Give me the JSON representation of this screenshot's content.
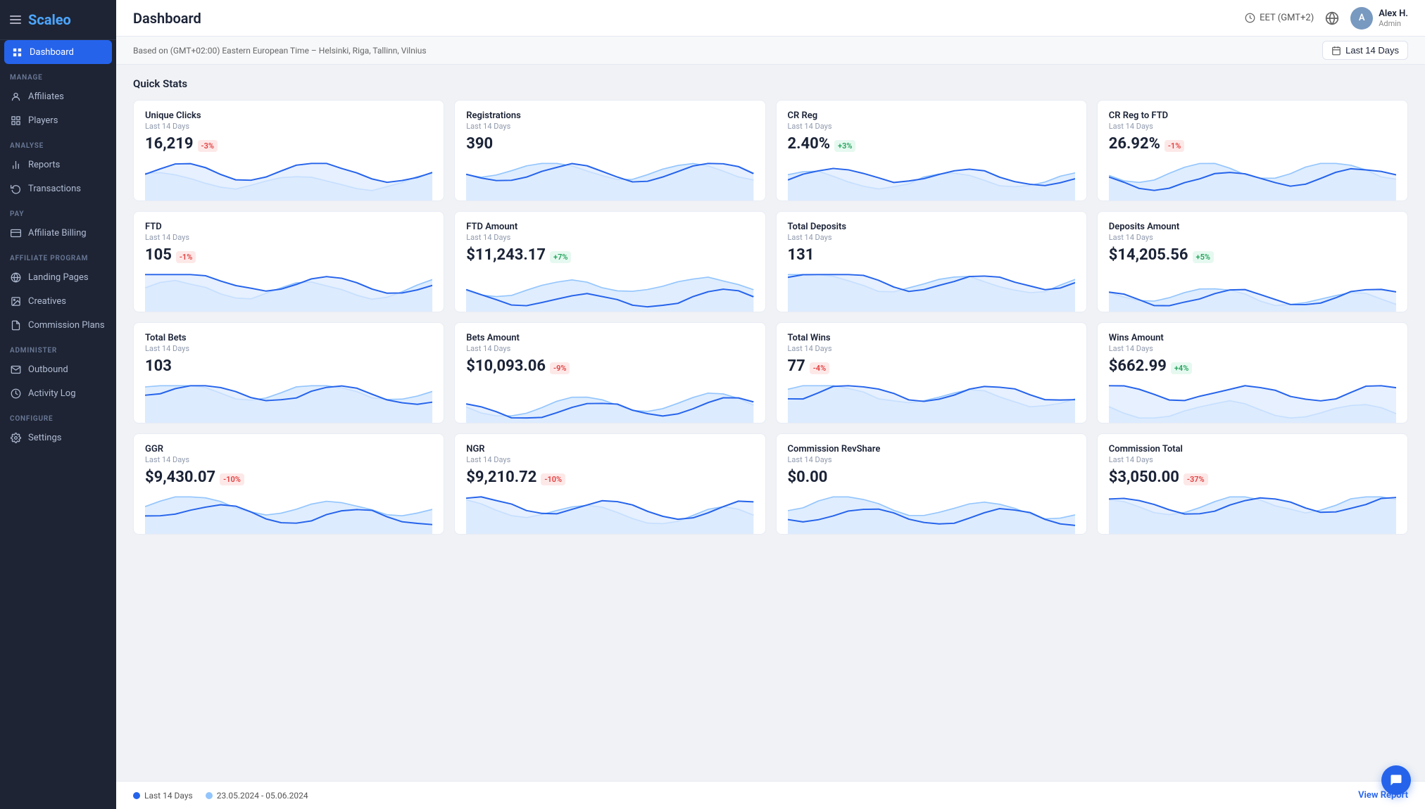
{
  "sidebar": {
    "logo": "Scaleo",
    "sections": [
      {
        "label": "Manage",
        "items": [
          {
            "id": "affiliates",
            "label": "Affiliates",
            "icon": "person-circle"
          },
          {
            "id": "players",
            "label": "Players",
            "icon": "grid"
          }
        ]
      },
      {
        "label": "Analyse",
        "items": [
          {
            "id": "reports",
            "label": "Reports",
            "icon": "bar-chart"
          },
          {
            "id": "transactions",
            "label": "Transactions",
            "icon": "refresh"
          }
        ]
      },
      {
        "label": "Pay",
        "items": [
          {
            "id": "affiliate-billing",
            "label": "Affiliate Billing",
            "icon": "credit-card"
          }
        ]
      },
      {
        "label": "Affiliate Program",
        "items": [
          {
            "id": "landing-pages",
            "label": "Landing Pages",
            "icon": "globe"
          },
          {
            "id": "creatives",
            "label": "Creatives",
            "icon": "image"
          },
          {
            "id": "commission-plans",
            "label": "Commission Plans",
            "icon": "document"
          }
        ]
      },
      {
        "label": "Administer",
        "items": [
          {
            "id": "outbound",
            "label": "Outbound",
            "icon": "mail"
          },
          {
            "id": "activity-log",
            "label": "Activity Log",
            "icon": "clock"
          }
        ]
      },
      {
        "label": "Configure",
        "items": [
          {
            "id": "settings",
            "label": "Settings",
            "icon": "gear"
          }
        ]
      }
    ]
  },
  "topbar": {
    "title": "Dashboard",
    "timezone": "EET (GMT+2)",
    "user_name": "Alex H.",
    "user_role": "Admin"
  },
  "subbar": {
    "info_text": "Based on (GMT+02:00) Eastern European Time – Helsinki, Riga, Tallinn, Vilnius",
    "date_range": "Last 14 Days"
  },
  "quick_stats": {
    "title": "Quick Stats",
    "cards": [
      {
        "label": "Unique Clicks",
        "period": "Last 14 Days",
        "value": "16,219",
        "badge": "-3%",
        "badge_type": "red",
        "chart_max": "1600",
        "chart_min": "0"
      },
      {
        "label": "Registrations",
        "period": "Last 14 Days",
        "value": "390",
        "badge": null,
        "badge_type": null,
        "chart_max": "80",
        "chart_min": "0"
      },
      {
        "label": "CR Reg",
        "period": "Last 14 Days",
        "value": "2.40%",
        "badge": "+3%",
        "badge_type": "green",
        "chart_max": "8",
        "chart_min": "0"
      },
      {
        "label": "CR Reg to FTD",
        "period": "Last 14 Days",
        "value": "26.92%",
        "badge": "-1%",
        "badge_type": "red",
        "chart_max": "100",
        "chart_min": "0"
      },
      {
        "label": "FTD",
        "period": "Last 14 Days",
        "value": "105",
        "badge": "-1%",
        "badge_type": "red",
        "chart_max": "10",
        "chart_min": "0"
      },
      {
        "label": "FTD Amount",
        "period": "Last 14 Days",
        "value": "$11,243.17",
        "badge": "+7%",
        "badge_type": "green",
        "chart_max": "1600",
        "chart_min": "0"
      },
      {
        "label": "Total Deposits",
        "period": "Last 14 Days",
        "value": "131",
        "badge": null,
        "badge_type": null,
        "chart_max": "20",
        "chart_min": "0"
      },
      {
        "label": "Deposits Amount",
        "period": "Last 14 Days",
        "value": "$14,205.56",
        "badge": "+5%",
        "badge_type": "green",
        "chart_max": "3000",
        "chart_min": "0"
      },
      {
        "label": "Total Bets",
        "period": "Last 14 Days",
        "value": "103",
        "badge": null,
        "badge_type": null,
        "chart_max": "14",
        "chart_min": "0"
      },
      {
        "label": "Bets Amount",
        "period": "Last 14 Days",
        "value": "$10,093.06",
        "badge": "-9%",
        "badge_type": "red",
        "chart_max": "1600",
        "chart_min": "0"
      },
      {
        "label": "Total Wins",
        "period": "Last 14 Days",
        "value": "77",
        "badge": "-4%",
        "badge_type": "red",
        "chart_max": "12",
        "chart_min": "0"
      },
      {
        "label": "Wins Amount",
        "period": "Last 14 Days",
        "value": "$662.99",
        "badge": "+4%",
        "badge_type": "green",
        "chart_max": "100",
        "chart_min": "0"
      },
      {
        "label": "GGR",
        "period": "Last 14 Days",
        "value": "$9,430.07",
        "badge": "-10%",
        "badge_type": "red",
        "chart_max": "1600",
        "chart_min": "0"
      },
      {
        "label": "NGR",
        "period": "Last 14 Days",
        "value": "$9,210.72",
        "badge": "-10%",
        "badge_type": "red",
        "chart_max": "1600",
        "chart_min": "0"
      },
      {
        "label": "Commission RevShare",
        "period": "Last 14 Days",
        "value": "$0.00",
        "badge": null,
        "badge_type": null,
        "chart_max": "4",
        "chart_min": "0"
      },
      {
        "label": "Commission Total",
        "period": "Last 14 Days",
        "value": "$3,050.00",
        "badge": "-37%",
        "badge_type": "red",
        "chart_max": "1000",
        "chart_min": "0"
      }
    ]
  },
  "footer": {
    "legend_items": [
      {
        "label": "Last 14 Days",
        "color": "#2563eb"
      },
      {
        "label": "23.05.2024 - 05.06.2024",
        "color": "#93c5fd"
      }
    ],
    "view_report_label": "View Report"
  }
}
